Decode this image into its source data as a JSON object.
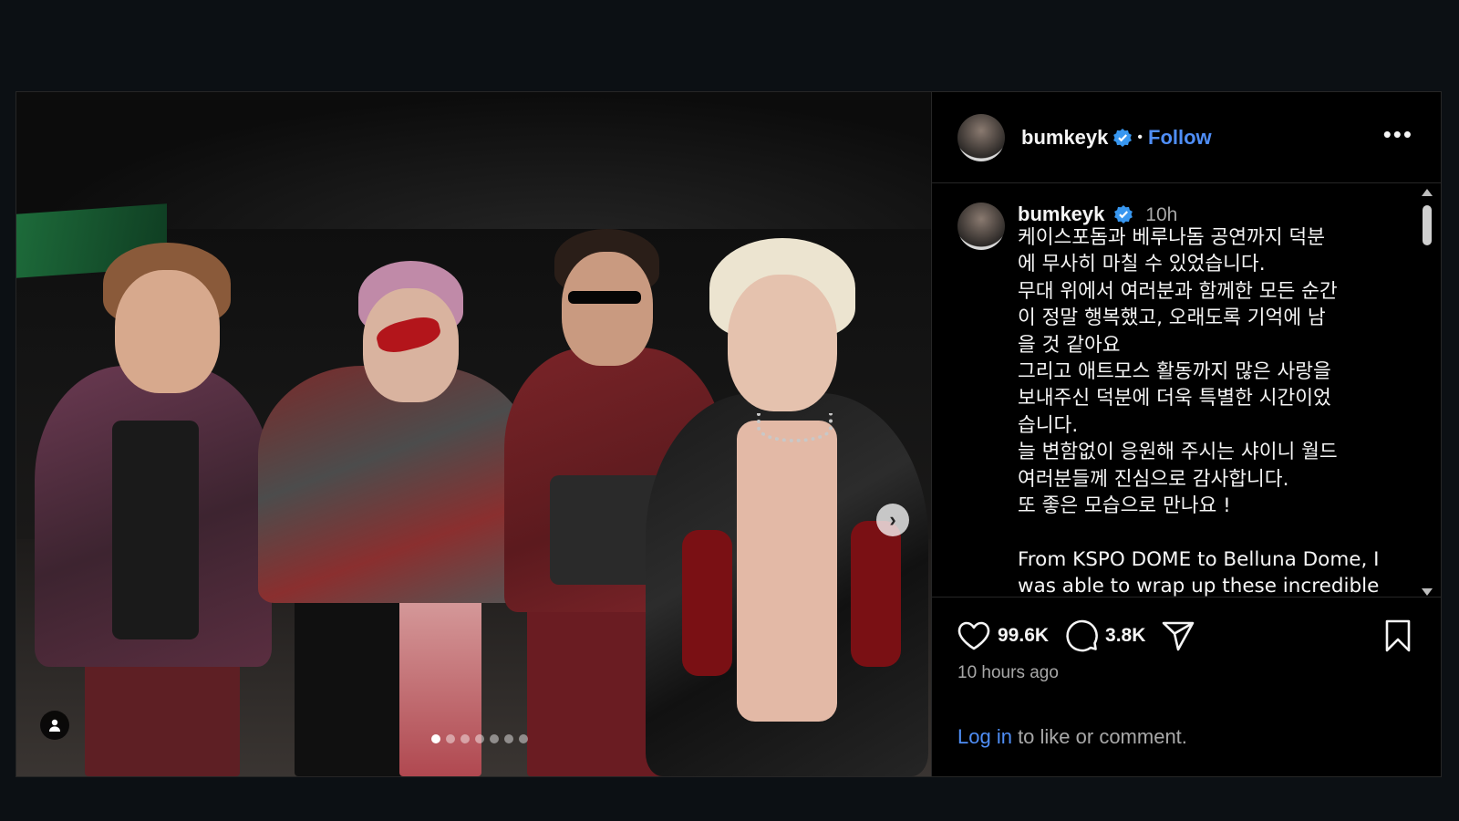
{
  "post": {
    "username": "bumkeyk",
    "follow_label": "Follow",
    "separator": "•",
    "more_label": "•••",
    "media_dots": 7,
    "active_dot": 0
  },
  "caption": {
    "username": "bumkeyk",
    "time": "10h",
    "text": "케이스포돔과 베루나돔 공연까지 덕분\n에 무사히 마칠 수 있었습니다.\n무대 위에서 여러분과 함께한 모든 순간\n이 정말 행복했고, 오래도록 기억에 남\n을 것 같아요\n그리고 애트모스 활동까지 많은 사랑을\n보내주신 덕분에 더욱 특별한 시간이었\n습니다.\n늘 변함없이 응원해 주시는 샤이니 월드\n여러분들께 진심으로 감사합니다.\n또 좋은 모습으로 만나요 !\n\nFrom KSPO DOME to Belluna Dome, I\nwas able to wrap up these incredible"
  },
  "actions": {
    "likes": "99.6K",
    "comments": "3.8K"
  },
  "posted_ago": "10 hours ago",
  "login": {
    "link": "Log in",
    "rest": " to like or comment."
  },
  "colors": {
    "background": "#0c1014",
    "link": "#4f8ef7",
    "verified": "#3897f0"
  }
}
